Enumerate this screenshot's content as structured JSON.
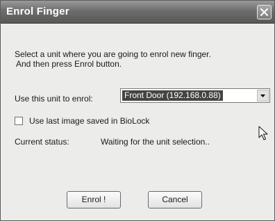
{
  "window": {
    "title": "Enrol Finger"
  },
  "instructions": {
    "line1": "Select a unit where you are going to enrol new finger.",
    "line2": "And then press Enrol button."
  },
  "unit": {
    "label": "Use this unit to enrol:",
    "selected": "Front Door (192.168.0.88)"
  },
  "option": {
    "label": "Use last image saved in BioLock",
    "checked": false
  },
  "status": {
    "label": "Current status:",
    "value": "Waiting for the unit selection.."
  },
  "buttons": {
    "enrol": "Enrol !",
    "cancel": "Cancel"
  },
  "icons": {
    "close": "close-icon",
    "dropdown": "chevron-down-icon",
    "cursor": "mouse-pointer-icon"
  }
}
